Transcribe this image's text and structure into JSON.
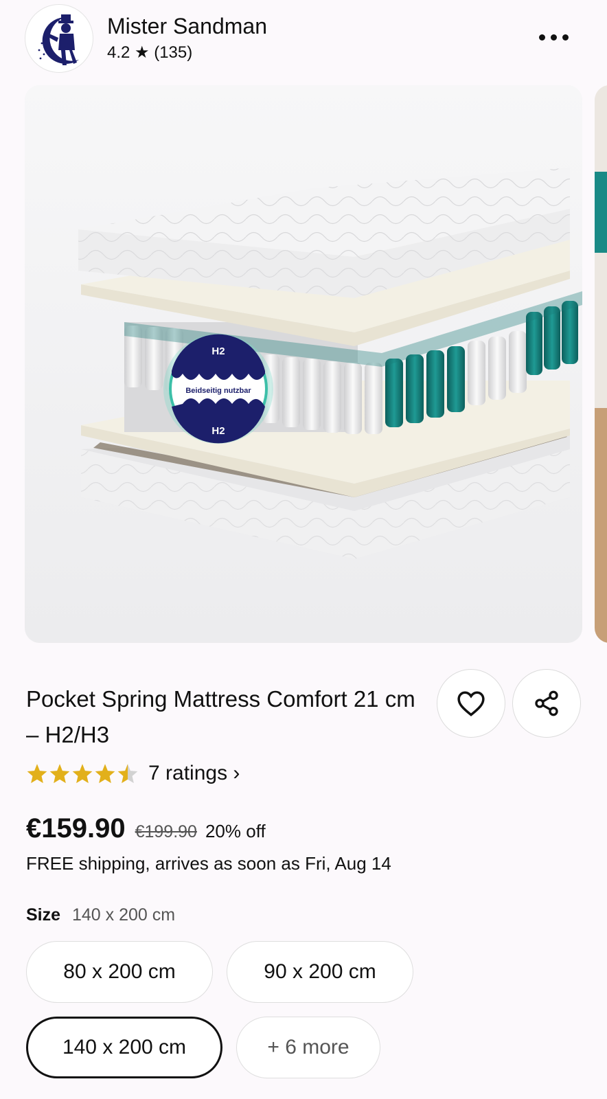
{
  "shop": {
    "name": "Mister Sandman",
    "rating": "4.2 ★ (135)",
    "more_icon": "more-horizontal-icon"
  },
  "image": {
    "badge_top": "H2",
    "badge_middle": "Beidseitig nutzbar",
    "badge_bottom": "H2"
  },
  "product": {
    "title": "Pocket Spring Mattress Comfort 21 cm – H2/H3",
    "rating_value": 4.5,
    "ratings_link": "7 ratings ›",
    "price": "€159.90",
    "old_price": "€199.90",
    "discount": "20% off",
    "shipping": "FREE shipping, arrives as soon as Fri, Aug 14"
  },
  "actions": {
    "favorite_icon": "heart-icon",
    "share_icon": "share-icon"
  },
  "size": {
    "label": "Size",
    "selected": "140 x 200 cm",
    "options": [
      "80 x 200 cm",
      "90 x 200 cm",
      "140 x 200 cm",
      "+ 6 more"
    ]
  },
  "colors": {
    "accent_teal": "#1a8a86",
    "star_gold": "#e2b01b",
    "badge_navy": "#1c1f6b"
  }
}
